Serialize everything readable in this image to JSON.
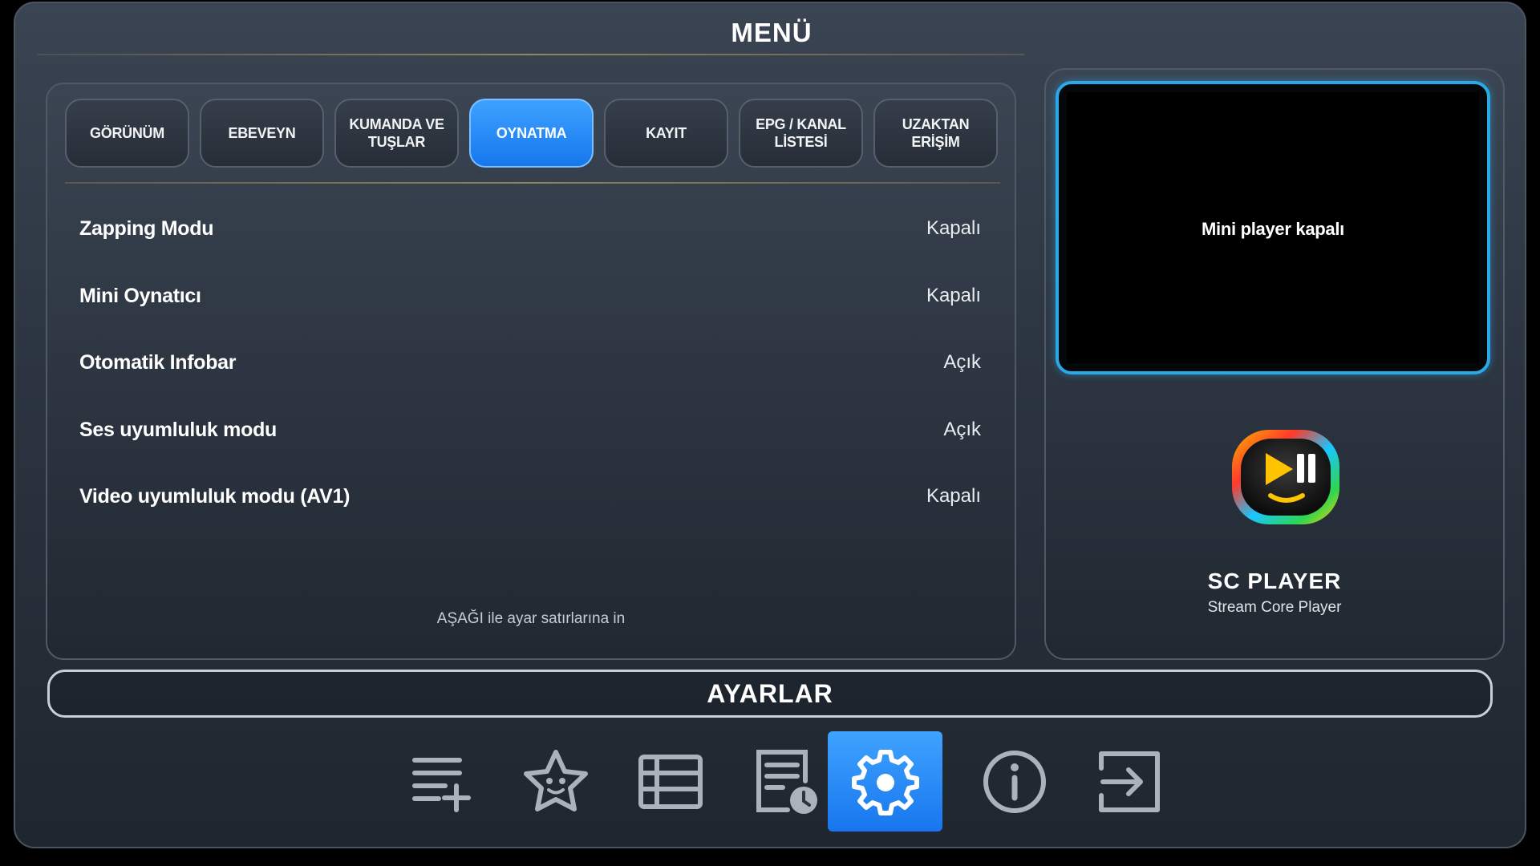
{
  "header": {
    "title": "MENÜ"
  },
  "tabs": [
    {
      "label": "GÖRÜNÜM",
      "active": false
    },
    {
      "label": "EBEVEYN",
      "active": false
    },
    {
      "label": "KUMANDA VE TUŞLAR",
      "active": false
    },
    {
      "label": "OYNATMA",
      "active": true
    },
    {
      "label": "KAYIT",
      "active": false
    },
    {
      "label": "EPG / KANAL LİSTESİ",
      "active": false
    },
    {
      "label": "UZAKTAN ERİŞİM",
      "active": false
    }
  ],
  "settings": [
    {
      "label": "Zapping Modu",
      "value": "Kapalı"
    },
    {
      "label": "Mini Oynatıcı",
      "value": "Kapalı"
    },
    {
      "label": "Otomatik Infobar",
      "value": "Açık"
    },
    {
      "label": "Ses uyumluluk modu",
      "value": "Açık"
    },
    {
      "label": "Video uyumluluk modu (AV1)",
      "value": "Kapalı"
    }
  ],
  "hint": "AŞAĞI ile ayar satırlarına in",
  "mini_player": {
    "status_text": "Mini player kapalı"
  },
  "brand": {
    "name": "SC PLAYER",
    "subtitle": "Stream Core Player",
    "logo_icon": "play-pause-logo-icon"
  },
  "section_title": "AYARLAR",
  "colors": {
    "accent": "#1e88f5",
    "player_border": "#2aa8e8",
    "background": "#2b3440"
  },
  "bottom_nav": [
    {
      "icon": "playlist-add-icon",
      "active": false
    },
    {
      "icon": "favorites-star-icon",
      "active": false
    },
    {
      "icon": "channel-list-icon",
      "active": false
    },
    {
      "icon": "epg-schedule-icon",
      "active": false
    },
    {
      "icon": "settings-gear-icon",
      "active": true
    },
    {
      "icon": "info-icon",
      "active": false
    },
    {
      "icon": "exit-icon",
      "active": false
    }
  ]
}
